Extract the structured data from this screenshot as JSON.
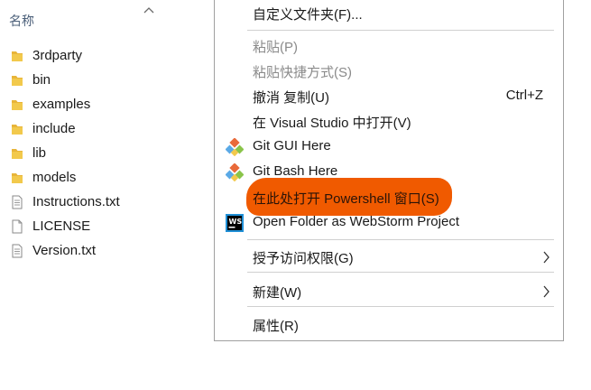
{
  "explorer": {
    "column_header": "名称",
    "files": [
      {
        "name": "3rdparty",
        "type": "folder"
      },
      {
        "name": "bin",
        "type": "folder"
      },
      {
        "name": "examples",
        "type": "folder"
      },
      {
        "name": "include",
        "type": "folder"
      },
      {
        "name": "lib",
        "type": "folder"
      },
      {
        "name": "models",
        "type": "folder"
      },
      {
        "name": "Instructions.txt",
        "type": "text-file"
      },
      {
        "name": "LICENSE",
        "type": "file"
      },
      {
        "name": "Version.txt",
        "type": "text-file"
      }
    ]
  },
  "context_menu": {
    "customize_folder": "自定义文件夹(F)...",
    "paste": "粘贴(P)",
    "paste_shortcut": "粘贴快捷方式(S)",
    "undo": "撤消 复制(U)",
    "undo_shortcut": "Ctrl+Z",
    "open_visual_studio": "在 Visual Studio 中打开(V)",
    "git_gui": "Git GUI Here",
    "git_bash": "Git Bash Here",
    "open_powershell": "在此处打开 Powershell 窗口(S)",
    "webstorm": "Open Folder as WebStorm Project",
    "webstorm_icon_text": "WS",
    "grant_access": "授予访问权限(G)",
    "new": "新建(W)",
    "properties": "属性(R)"
  },
  "colors": {
    "highlight": "#f05a00",
    "folder": "#e8b53a",
    "git_diamond": "#e96a3a",
    "disabled_text": "#8a8a8a"
  },
  "icons": {
    "folder": "folder-icon",
    "text_file": "text-file-icon",
    "file": "file-icon",
    "git": "git-icon",
    "webstorm": "webstorm-icon",
    "submenu": "chevron-right-icon",
    "sort": "chevron-up-icon"
  }
}
